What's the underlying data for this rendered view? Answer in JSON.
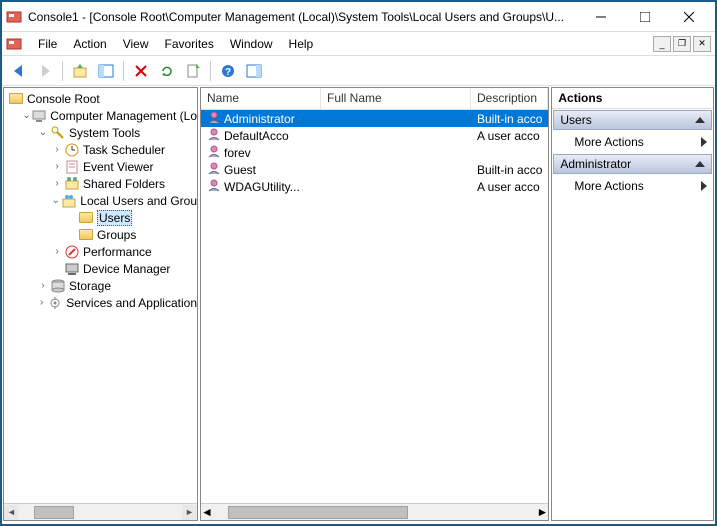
{
  "window": {
    "title": "Console1 - [Console Root\\Computer Management (Local)\\System Tools\\Local Users and Groups\\U..."
  },
  "menu": {
    "items": [
      "File",
      "Action",
      "View",
      "Favorites",
      "Window",
      "Help"
    ]
  },
  "tree": {
    "root": "Console Root",
    "nodes": [
      {
        "label": "Computer Management (Lo",
        "depth": 1,
        "expanded": true,
        "icon": "computer"
      },
      {
        "label": "System Tools",
        "depth": 2,
        "expanded": true,
        "icon": "tools"
      },
      {
        "label": "Task Scheduler",
        "depth": 3,
        "expanded": false,
        "icon": "clock",
        "hasChildren": true
      },
      {
        "label": "Event Viewer",
        "depth": 3,
        "expanded": false,
        "icon": "event",
        "hasChildren": true
      },
      {
        "label": "Shared Folders",
        "depth": 3,
        "expanded": false,
        "icon": "shared",
        "hasChildren": true
      },
      {
        "label": "Local Users and Grou",
        "depth": 3,
        "expanded": true,
        "icon": "users",
        "hasChildren": true
      },
      {
        "label": "Users",
        "depth": 4,
        "icon": "folder",
        "selected": true
      },
      {
        "label": "Groups",
        "depth": 4,
        "icon": "folder"
      },
      {
        "label": "Performance",
        "depth": 3,
        "expanded": false,
        "icon": "perf",
        "hasChildren": true
      },
      {
        "label": "Device Manager",
        "depth": 3,
        "icon": "device"
      },
      {
        "label": "Storage",
        "depth": 2,
        "expanded": false,
        "icon": "storage",
        "hasChildren": true
      },
      {
        "label": "Services and Application",
        "depth": 2,
        "expanded": false,
        "icon": "services",
        "hasChildren": true
      }
    ]
  },
  "list": {
    "columns": [
      "Name",
      "Full Name",
      "Description"
    ],
    "rows": [
      {
        "name": "Administrator",
        "full": "",
        "desc": "Built-in acco",
        "selected": true
      },
      {
        "name": "DefaultAcco",
        "full": "",
        "desc": "A user acco"
      },
      {
        "name": "forev",
        "full": "",
        "desc": ""
      },
      {
        "name": "Guest",
        "full": "",
        "desc": "Built-in acco"
      },
      {
        "name": "WDAGUtility...",
        "full": "",
        "desc": "A user acco"
      }
    ]
  },
  "actions": {
    "title": "Actions",
    "sections": [
      {
        "header": "Users",
        "links": [
          "More Actions"
        ]
      },
      {
        "header": "Administrator",
        "links": [
          "More Actions"
        ]
      }
    ]
  }
}
